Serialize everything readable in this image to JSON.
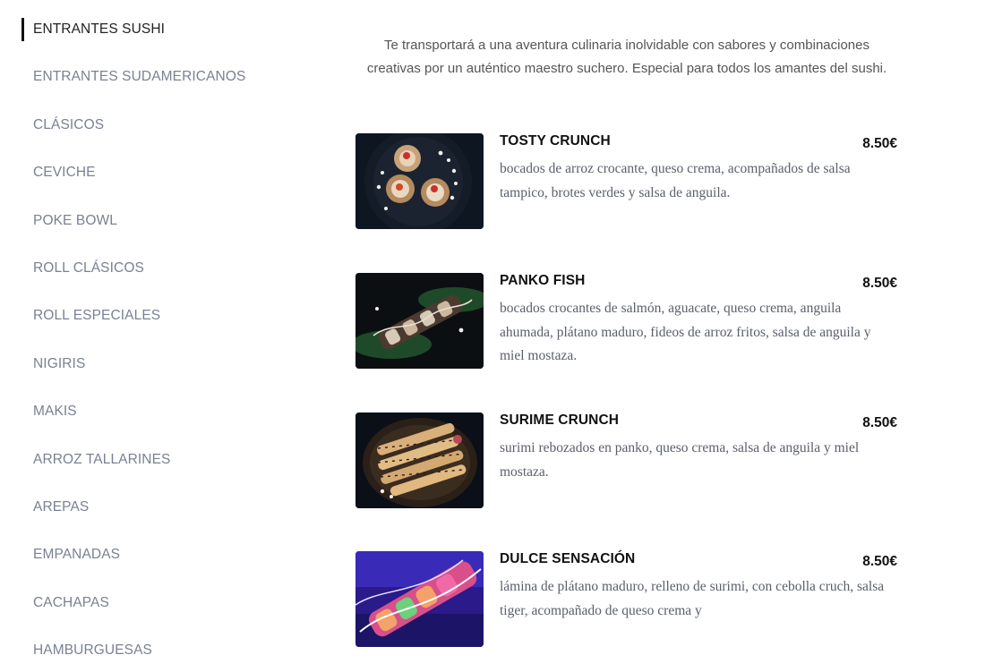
{
  "sidebar": {
    "categories": [
      "ENTRANTES SUSHI",
      "ENTRANTES SUDAMERICANOS",
      "CLÁSICOS",
      "CEVICHE",
      "POKE BOWL",
      "ROLL CLÁSICOS",
      "ROLL ESPECIALES",
      "NIGIRIS",
      "MAKIS",
      "ARROZ TALLARINES",
      "AREPAS",
      "EMPANADAS",
      "CACHAPAS",
      "HAMBURGUESAS"
    ],
    "active": "ENTRANTES SUSHI"
  },
  "intro": {
    "line1": "Te transportará a una aventura culinaria inolvidable con sabores y combinaciones",
    "line2": "creativas por un auténtico maestro suchero. Especial para todos los amantes del sushi."
  },
  "dishes": [
    {
      "name": "TOSTY CRUNCH",
      "price": "8.50€",
      "description": "bocados de arroz crocante, queso crema, acompañados de salsa tampico, brotes verdes y salsa de anguila."
    },
    {
      "name": "PANKO FISH",
      "price": "8.50€",
      "description": "bocados crocantes de salmón, aguacate, queso crema, anguila ahumada, plátano maduro, fideos de arroz fritos, salsa de anguila y miel mostaza."
    },
    {
      "name": "SURIME CRUNCH",
      "price": "8.50€",
      "description": "surimi rebozados en panko, queso crema, salsa de anguila y miel mostaza."
    },
    {
      "name": "DULCE SENSACIÓN",
      "price": "8.50€",
      "description": "lámina de plátano maduro, relleno de surimi, con cebolla cruch, salsa tiger, acompañado de queso crema y"
    }
  ]
}
